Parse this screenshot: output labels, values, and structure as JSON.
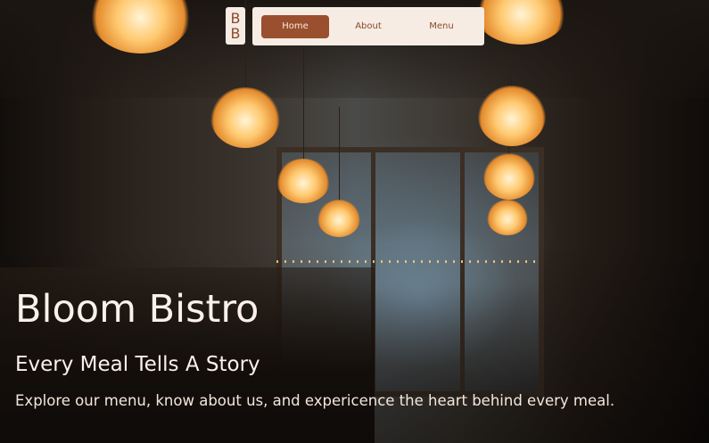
{
  "brand": {
    "logo_line1": "B",
    "logo_line2": "B"
  },
  "nav": {
    "items": [
      {
        "label": "Home",
        "active": true
      },
      {
        "label": "About",
        "active": false
      },
      {
        "label": "Menu",
        "active": false
      }
    ]
  },
  "hero": {
    "title": "Bloom Bistro",
    "subtitle": "Every Meal Tells A Story",
    "tagline": "Explore our menu, know about us, and expericence the heart behind every meal."
  },
  "colors": {
    "nav_background": "#f6ece3",
    "accent": "#9a4f2e",
    "hero_text": "#fbf1ea"
  }
}
